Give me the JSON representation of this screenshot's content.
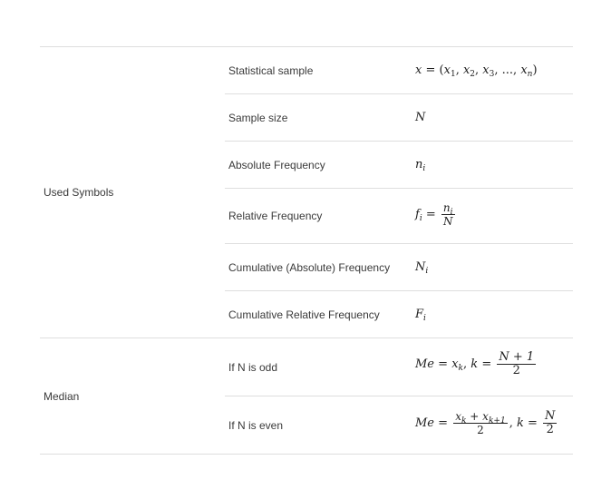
{
  "sections": [
    {
      "label": "Used Symbols",
      "rows": [
        {
          "description": "Statistical sample",
          "formula": {
            "lhs": "x",
            "eq": "=",
            "items": [
              "x",
              "1",
              "x",
              "2",
              "x",
              "3",
              "...",
              "x",
              "n"
            ]
          }
        },
        {
          "description": "Sample size",
          "formula": {
            "symbol": "N"
          }
        },
        {
          "description": "Absolute Frequency",
          "formula": {
            "symbol": "n",
            "sub": "i"
          }
        },
        {
          "description": "Relative Frequency",
          "formula": {
            "lhs": "f",
            "lhs_sub": "i",
            "eq": "=",
            "num": "n",
            "num_sub": "i",
            "den": "N"
          }
        },
        {
          "description": "Cumulative (Absolute) Frequency",
          "formula": {
            "symbol": "N",
            "sub": "i"
          }
        },
        {
          "description": "Cumulative Relative Frequency",
          "formula": {
            "symbol": "F",
            "sub": "i"
          }
        }
      ]
    },
    {
      "label": "Median",
      "rows": [
        {
          "description": "If N is odd",
          "formula": {
            "lhs": "Me",
            "eq": "=",
            "x": "x",
            "k": "k",
            "num": "N + 1",
            "den": "2"
          }
        },
        {
          "description": "If N is even",
          "formula": {
            "lhs": "Me",
            "eq": "=",
            "num_a": "x",
            "num_a_sub": "k",
            "plus": "+",
            "num_b": "x",
            "num_b_sub": "k+1",
            "den": "2",
            "k": "k",
            "num2": "N",
            "den2": "2"
          }
        }
      ]
    }
  ]
}
